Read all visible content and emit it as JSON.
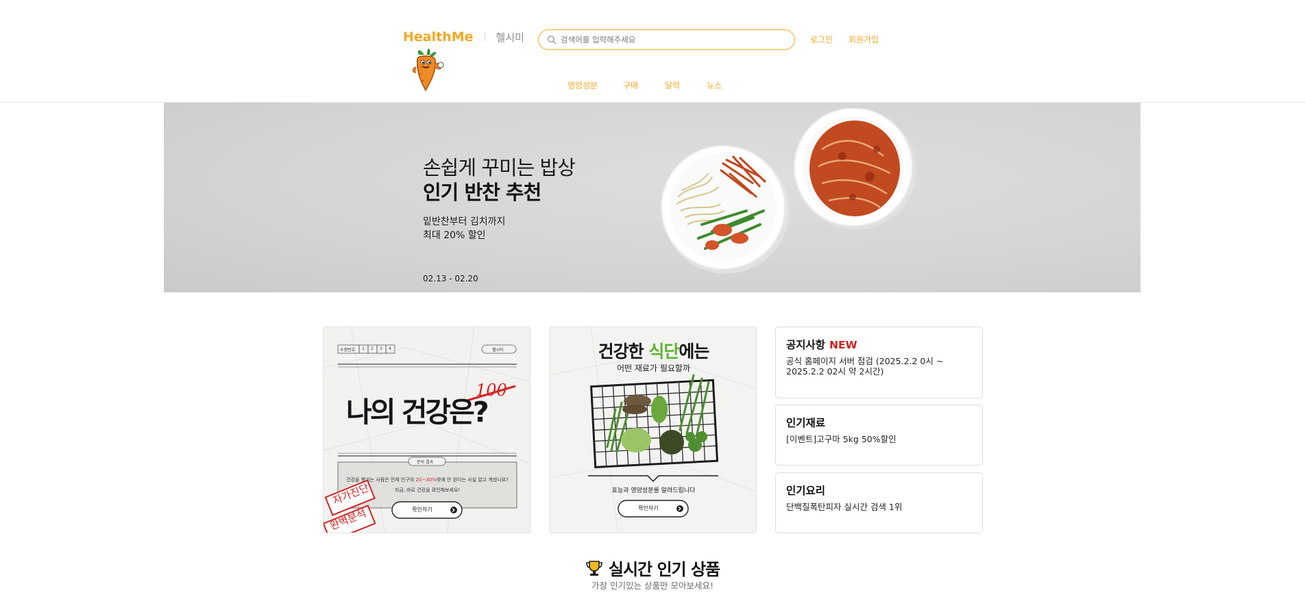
{
  "header": {
    "brand": "HealthMe",
    "brand_kor": "헬시미",
    "search_placeholder": "검색어를 입력해주세요",
    "login": "로그인",
    "signup": "회원가입",
    "nav": [
      "영양성분",
      "구매",
      "달력",
      "뉴스"
    ],
    "accent_color": "#f5a623"
  },
  "banner": {
    "title_line1": "손쉽게 꾸미는 밥상",
    "title_line2": "인기 반찬 추천",
    "sub_line1": "밑반찬부터 김치까지",
    "sub_line2": "최대 20% 할인",
    "date": "02.13 - 02.20"
  },
  "card1": {
    "tabs_label": "수정번호",
    "tabs": [
      "1",
      "2",
      "3",
      "4"
    ],
    "tag": "헬시미",
    "headline": "나의 건강은?",
    "score": "100",
    "badge": "분석 결과",
    "desc_line1_a": "건강을 챙기는 사람은 전체 인구의 ",
    "desc_line1_highlight": "20~30%",
    "desc_line1_b": "밖에 안 된다는 사실 알고 계셨나요?",
    "desc_line2": "지금, 바로 건강을 확인해보세요!",
    "button": "확인하기",
    "stamp1": "자가진단",
    "stamp2": "완벽분석"
  },
  "card2": {
    "headline_a": "건강한 ",
    "headline_highlight": "식단",
    "headline_b": "에는",
    "subhead": "어떤 재료가 필요할까",
    "desc": "효능과 영양성분를 알려드립니다",
    "button": "확인하기"
  },
  "info": [
    {
      "title": "공지사항",
      "new": "NEW",
      "body": "공식 홈페이지 서버 점검 (2025.2.2 0시 ~ 2025.2.2 02시 약 2시간)"
    },
    {
      "title": "인기재료",
      "body": "[이벤트]고구마 5kg 50%할인"
    },
    {
      "title": "인기요리",
      "body": "단백질폭탄피자 실시간 검색 1위"
    }
  ],
  "section": {
    "title": "실시간 인기 상품",
    "subtitle": "가장 인기있는 상품만 모아보세요!"
  }
}
